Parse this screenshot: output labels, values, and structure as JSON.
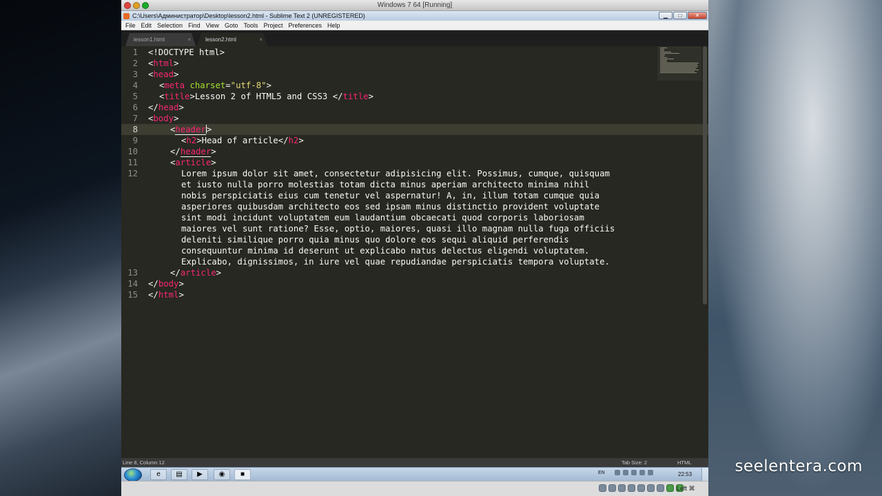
{
  "host": {
    "window_title": "Windows 7 64 [Running]",
    "watermark": "seelentera.com",
    "host_key": "Left ⌘"
  },
  "app": {
    "title": "C:\\Users\\Администратор\\Desktop\\lesson2.html - Sublime Text 2 (UNREGISTERED)",
    "minimize": "▁",
    "maximize": "□",
    "close": "✕"
  },
  "menu": [
    "File",
    "Edit",
    "Selection",
    "Find",
    "View",
    "Goto",
    "Tools",
    "Project",
    "Preferences",
    "Help"
  ],
  "tabs": [
    {
      "label": "lesson1.html",
      "close": "×",
      "active": false
    },
    {
      "label": "lesson2.html",
      "close": "×",
      "active": true
    }
  ],
  "line_numbers": [
    "1",
    "2",
    "3",
    "4",
    "5",
    "6",
    "7",
    "8",
    "9",
    "10",
    "11",
    "12",
    "13",
    "14",
    "15"
  ],
  "code": {
    "l1": "<!DOCTYPE html>",
    "l2_tag": "html",
    "l3_tag": "head",
    "l4_tag": "meta",
    "l4_attr": "charset",
    "l4_val": "\"utf-8\"",
    "l5_tag": "title",
    "l5_text": "Lesson 2 of HTML5 and CSS3 ",
    "l6_tag": "head",
    "l7_tag": "body",
    "l8_tag": "header",
    "l9_tag": "h2",
    "l9_text": "Head of article",
    "l10_tag": "header",
    "l11_tag": "article",
    "l12_text": [
      "Lorem ipsum dolor sit amet, consectetur adipisicing elit. Possimus, cumque, quisquam",
      "et iusto nulla porro molestias totam dicta minus aperiam architecto minima nihil",
      "nobis perspiciatis eius cum tenetur vel aspernatur! A, in, illum totam cumque quia",
      "asperiores quibusdam architecto eos sed ipsam minus distinctio provident voluptate",
      "sint modi incidunt voluptatem eum laudantium obcaecati quod corporis laboriosam",
      "maiores vel sunt ratione? Esse, optio, maiores, quasi illo magnam nulla fuga officiis",
      "deleniti similique porro quia minus quo dolore eos sequi aliquid perferendis",
      "consequuntur minima id deserunt ut explicabo natus delectus eligendi voluptatem.",
      "Explicabo, dignissimos, in iure vel quae repudiandae perspiciatis tempora voluptate."
    ],
    "l13_tag": "article",
    "l14_tag": "body",
    "l15_tag": "html"
  },
  "status": {
    "position": "Line 8, Column 12",
    "tab_size": "Tab Size: 2",
    "syntax": "HTML"
  },
  "taskbar": {
    "language": "EN",
    "clock": "22:53"
  },
  "colors": {
    "editor_bg": "#272822",
    "tag": "#f92672",
    "attr": "#a6e22e",
    "string": "#e6db74",
    "text": "#f8f8f2"
  }
}
